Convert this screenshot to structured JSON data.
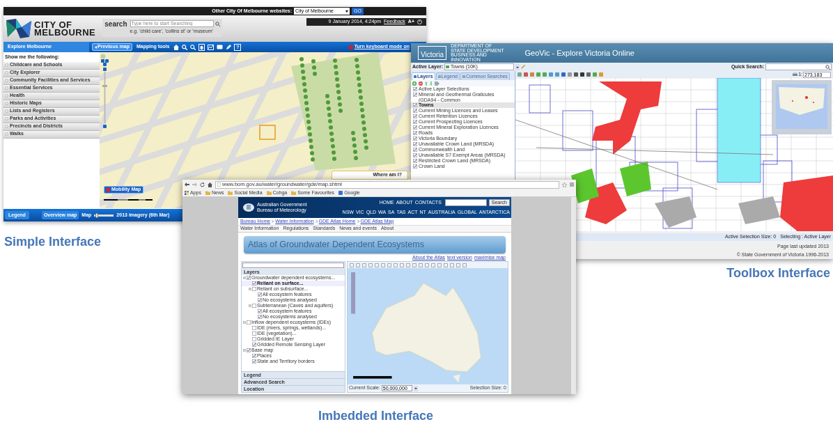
{
  "melbourne": {
    "top_bar": {
      "label": "Other City Of Melbourne websites:",
      "select": "City of Melbourne",
      "go": "GO"
    },
    "logo_lines": [
      "CITY OF",
      "MELBOURNE"
    ],
    "search": {
      "label": "search",
      "placeholder": "Type here to start Searching",
      "hint": "e.g. 'child care', 'collins st' or 'museum'"
    },
    "info": {
      "date": "9 January 2014, 4:24pm",
      "feedback": "Feedback",
      "text_size": "A+"
    },
    "nav": {
      "tab": "Explore Melbourne",
      "previous": "Previous map",
      "tools": "Mapping tools",
      "help": "?",
      "keyboard": "Turn keyboard mode on"
    },
    "sidebar": {
      "heading": "Show me the following:",
      "items": [
        "Childcare and Schools",
        "City Explorer",
        "Community Facilities and Services",
        "Essential Services",
        "Health",
        "Historic Maps",
        "Lists and Registers",
        "Parks and Activities",
        "Precincts and Districts",
        "Walks"
      ]
    },
    "map": {
      "mobility": "Mobility Map",
      "where": "Where am I?"
    },
    "bottom": {
      "legend": "Legend",
      "overview": "Overview map",
      "map_label": "Map",
      "level": 0.05,
      "imagery": "2013 imagery (6th Mar)"
    },
    "caption": "Simple Interface"
  },
  "victoria": {
    "logo": "Victoria",
    "department_lines": [
      "DEPARTMENT OF",
      "STATE DEVELOPMENT",
      "BUSINESS AND",
      "INNOVATION"
    ],
    "title": "GeoVic - Explore Victoria Online",
    "active_layer": {
      "label": "Active Layer:",
      "value": "Towns (10K)"
    },
    "quick_search": "Quick Search:",
    "tabs": [
      {
        "label": "Layers",
        "selected": true
      },
      {
        "label": "Legend",
        "selected": false
      },
      {
        "label": "Common Searches",
        "selected": false
      }
    ],
    "layers": [
      {
        "label": "Active Layer Selections",
        "checked": true,
        "selected": false
      },
      {
        "label": "Mineral and Geothermal Graticules (GDA94 - Common",
        "checked": true,
        "selected": false
      },
      {
        "label": "Towns",
        "checked": true,
        "selected": true
      },
      {
        "label": "Current Mining Licences and Leases",
        "checked": true,
        "selected": false
      },
      {
        "label": "Current Retention Licences",
        "checked": true,
        "selected": false
      },
      {
        "label": "Current Prospecting Licences",
        "checked": true,
        "selected": false
      },
      {
        "label": "Current Mineral Exploration Licences",
        "checked": true,
        "selected": false
      },
      {
        "label": "Roads",
        "checked": true,
        "selected": false
      },
      {
        "label": "Victoria Boundary",
        "checked": true,
        "selected": false
      },
      {
        "label": "Unavailable Crown Land (MRSDA)",
        "checked": true,
        "selected": false
      },
      {
        "label": "Commonwealth Land",
        "checked": true,
        "selected": false
      },
      {
        "label": "Unavailable S7 Exempt Areas (MRSDA)",
        "checked": true,
        "selected": false
      },
      {
        "label": "Restricted Crown Land (MRSDA)",
        "checked": true,
        "selected": false
      },
      {
        "label": "Crown Land",
        "checked": true,
        "selected": false
      }
    ],
    "scale_prefix": "1:",
    "scale": "273,183",
    "status": [
      "Active Selection Size: 0",
      "Selecting : Active Layer"
    ],
    "footer": [
      "Page last updated 2013",
      "© State Government of Victoria 1996-2013"
    ],
    "caption": "Toolbox Interface"
  },
  "bom": {
    "url": "www.bom.gov.au/water/groundwater/gde/map.shtml",
    "bookmarks": [
      {
        "kind": "apps",
        "label": "Apps"
      },
      {
        "kind": "folder",
        "label": "News"
      },
      {
        "kind": "folder",
        "label": "Social Media"
      },
      {
        "kind": "folder",
        "label": "Cohga"
      },
      {
        "kind": "folder",
        "label": "Some Favourites"
      },
      {
        "kind": "site",
        "label": "Google"
      }
    ],
    "agency_lines": [
      "Australian Government",
      "Bureau of Meteorology"
    ],
    "top_links": [
      "HOME",
      "ABOUT",
      "CONTACTS"
    ],
    "search_button": "Search",
    "regions": [
      "NSW",
      "VIC",
      "QLD",
      "WA",
      "SA",
      "TAS",
      "ACT",
      "NT",
      "AUSTRALIA",
      "GLOBAL",
      "ANTARCTICA"
    ],
    "breadcrumb": [
      "Bureau Home",
      "Water Information",
      "GDE Atlas Home",
      "GDE Atlas Map"
    ],
    "nav": [
      "Water Information",
      "Regulations",
      "Standards",
      "News and events",
      "About"
    ],
    "banner": "Atlas of Groundwater Dependent Ecosystems",
    "page_links": [
      "About the Atlas",
      "text version",
      "maximise map"
    ],
    "layers_heading": "Layers",
    "tree": [
      {
        "label": "Groundwater dependent ecosystems...",
        "checked": true,
        "selected": false,
        "children": [
          {
            "label": "Reliant on surface...",
            "checked": true,
            "selected": true
          },
          {
            "label": "Reliant on subsurface...",
            "checked": false,
            "selected": false,
            "children": [
              {
                "label": "All ecosystem features",
                "checked": true,
                "selected": false
              },
              {
                "label": "No ecosystems analysed",
                "checked": true,
                "selected": false
              }
            ]
          },
          {
            "label": "Subterranean (Caves and aquifers)",
            "checked": false,
            "selected": false,
            "children": [
              {
                "label": "All ecosystem features",
                "checked": true,
                "selected": false
              },
              {
                "label": "No ecosystems analysed",
                "checked": true,
                "selected": false
              }
            ]
          }
        ]
      },
      {
        "label": "Inflow dependent ecosystems (IDEs)",
        "checked": false,
        "selected": false,
        "children": [
          {
            "label": "IDE (rivers, springs, wetlands)...",
            "checked": false,
            "selected": false
          },
          {
            "label": "IDE (vegetation)...",
            "checked": false,
            "selected": false
          },
          {
            "label": "Gridded IE Layer",
            "checked": false,
            "selected": false
          },
          {
            "label": "Gridded Remote Sensing Layer",
            "checked": true,
            "selected": false
          }
        ]
      },
      {
        "label": "Base map",
        "checked": true,
        "selected": false,
        "children": [
          {
            "label": "Places",
            "checked": true,
            "selected": false
          },
          {
            "label": "State and Territory borders",
            "checked": true,
            "selected": false
          }
        ]
      }
    ],
    "sections": [
      "Legend",
      "Advanced Search",
      "Location"
    ],
    "scale_label": "Current Scale:",
    "scale": "50,000,000",
    "selection": "Selection Size: 0",
    "caption": "Imbedded Interface"
  }
}
